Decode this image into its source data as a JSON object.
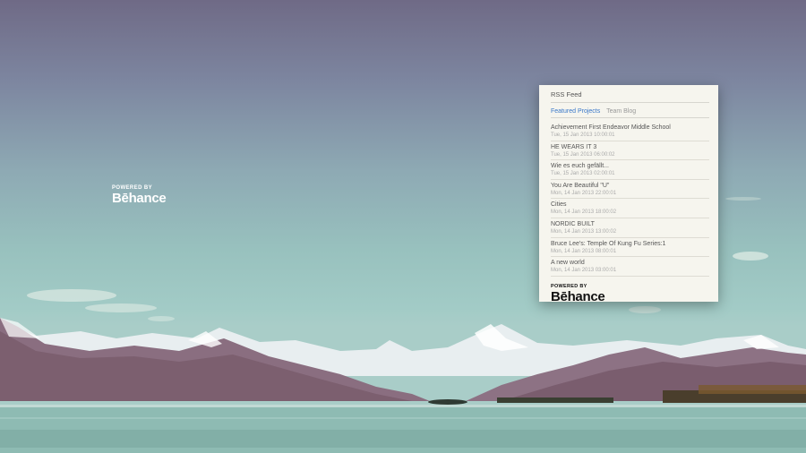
{
  "widget": {
    "title": "RSS Feed",
    "tabs": [
      {
        "label": "Featured Projects",
        "active": true
      },
      {
        "label": "Team Blog",
        "active": false
      }
    ],
    "items": [
      {
        "title": "Achievement First Endeavor Middle School",
        "date": "Tue, 15 Jan 2013 10:00:01"
      },
      {
        "title": "HE WEARS IT 3",
        "date": "Tue, 15 Jan 2013 06:00:02"
      },
      {
        "title": "Wie es euch gefällt...",
        "date": "Tue, 15 Jan 2013 02:00:01"
      },
      {
        "title": "You Are Beautiful \"U\"",
        "date": "Mon, 14 Jan 2013 22:00:01"
      },
      {
        "title": "Cities",
        "date": "Mon, 14 Jan 2013 18:00:02"
      },
      {
        "title": "NORDIC BUILT",
        "date": "Mon, 14 Jan 2013 13:00:02"
      },
      {
        "title": "Bruce Lee's: Temple Of Kung Fu Series:1",
        "date": "Mon, 14 Jan 2013 08:00:01"
      },
      {
        "title": "A new world",
        "date": "Mon, 14 Jan 2013 03:00:01"
      }
    ],
    "footer": {
      "powered_by": "POWERED BY",
      "brand": "Bēhance"
    }
  },
  "desktop": {
    "watermark": {
      "powered_by": "POWERED BY",
      "brand": "Bēhance"
    }
  }
}
